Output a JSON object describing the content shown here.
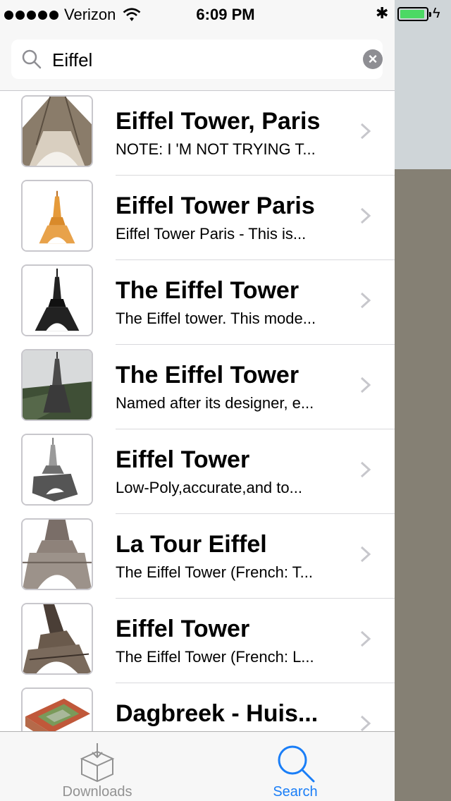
{
  "status_bar": {
    "carrier": "Verizon",
    "time": "6:09 PM",
    "battery_color": "#4cd964"
  },
  "search": {
    "value": "Eiffel",
    "placeholder": "Search"
  },
  "results": [
    {
      "title": "Eiffel Tower, Paris",
      "subtitle": "NOTE: I 'M NOT TRYING T..."
    },
    {
      "title": "Eiffel Tower Paris",
      "subtitle": "Eiffel Tower Paris - This is..."
    },
    {
      "title": "The Eiffel Tower",
      "subtitle": "The Eiffel tower. This mode..."
    },
    {
      "title": "The Eiffel Tower",
      "subtitle": "Named after its designer, e..."
    },
    {
      "title": "Eiffel Tower",
      "subtitle": "Low-Poly,accurate,and to..."
    },
    {
      "title": "La Tour Eiffel",
      "subtitle": "The Eiffel Tower (French: T..."
    },
    {
      "title": "Eiffel Tower",
      "subtitle": "The Eiffel Tower (French: L..."
    },
    {
      "title": "Dagbreek - Huis...",
      "subtitle": ""
    }
  ],
  "tabbar": {
    "downloads_label": "Downloads",
    "search_label": "Search",
    "active_color": "#1a7ef7",
    "inactive_color": "#929292"
  }
}
